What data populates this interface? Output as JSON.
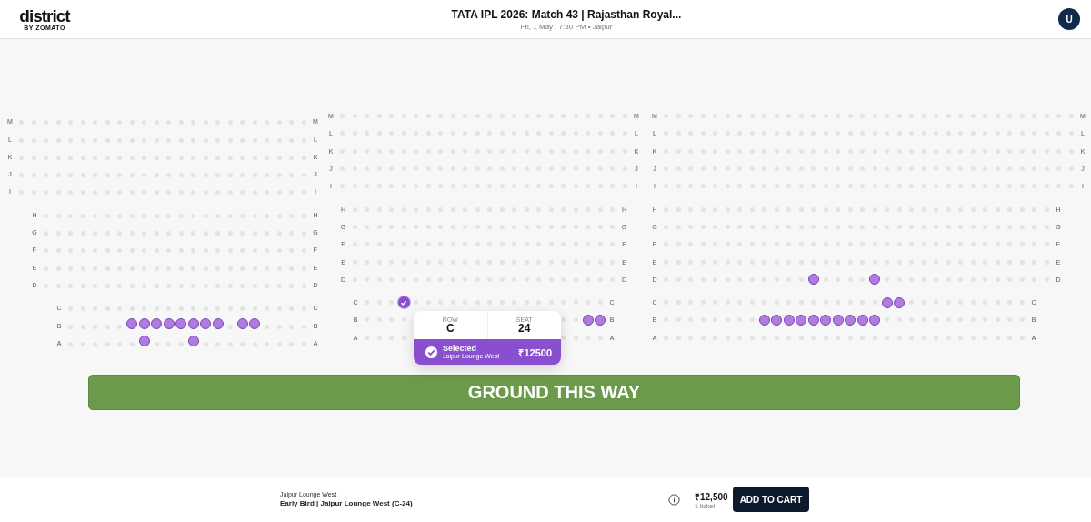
{
  "header": {
    "logo": "district",
    "logo_sub": "BY ZOMATO",
    "title": "TATA IPL 2026: Match 43 | Rajasthan Royal...",
    "subtitle": "Fri, 1 May | 7:30 PM • Jaipur",
    "avatar": "U"
  },
  "blocks": [
    {
      "tiers": [
        {
          "rows": [
            {
              "label_left": "M",
              "label_right": "M",
              "available": [
                false,
                false,
                false,
                false,
                false,
                false,
                false,
                false,
                false,
                false,
                false,
                false,
                false,
                false,
                false,
                false,
                false,
                false,
                false,
                false,
                false,
                false,
                false,
                false
              ]
            },
            {
              "label_left": "L",
              "label_right": "L",
              "available": [
                false,
                false,
                false,
                false,
                false,
                false,
                false,
                false,
                false,
                false,
                false,
                false,
                false,
                false,
                false,
                false,
                false,
                false,
                false,
                false,
                false,
                false,
                false,
                false
              ]
            },
            {
              "label_left": "K",
              "label_right": "K",
              "available": [
                false,
                false,
                false,
                false,
                false,
                false,
                false,
                false,
                false,
                false,
                false,
                false,
                false,
                false,
                false,
                false,
                false,
                false,
                false,
                false,
                false,
                false,
                false,
                false
              ]
            },
            {
              "label_left": "J",
              "label_right": "J",
              "available": [
                false,
                false,
                false,
                false,
                false,
                false,
                false,
                false,
                false,
                false,
                false,
                false,
                false,
                false,
                false,
                false,
                false,
                false,
                false,
                false,
                false,
                false,
                false,
                false
              ]
            },
            {
              "label_left": "I",
              "label_right": "I",
              "available": [
                false,
                false,
                false,
                false,
                false,
                false,
                false,
                false,
                false,
                false,
                false,
                false,
                false,
                false,
                false,
                false,
                false,
                false,
                false,
                false,
                false,
                false,
                false,
                false
              ]
            }
          ]
        },
        {
          "rows": [
            {
              "label_left": "H",
              "label_right": "H",
              "available": [
                false,
                false,
                false,
                false,
                false,
                false,
                false,
                false,
                false,
                false,
                false,
                false,
                false,
                false,
                false,
                false,
                false,
                false,
                false,
                false,
                false,
                false
              ]
            },
            {
              "label_left": "G",
              "label_right": "G",
              "available": [
                false,
                false,
                false,
                false,
                false,
                false,
                false,
                false,
                false,
                false,
                false,
                false,
                false,
                false,
                false,
                false,
                false,
                false,
                false,
                false,
                false,
                false
              ]
            },
            {
              "label_left": "F",
              "label_right": "F",
              "available": [
                false,
                false,
                false,
                false,
                false,
                false,
                false,
                false,
                false,
                false,
                false,
                false,
                false,
                false,
                false,
                false,
                false,
                false,
                false,
                false,
                false,
                false
              ]
            },
            {
              "label_left": "E",
              "label_right": "E",
              "available": [
                false,
                false,
                false,
                false,
                false,
                false,
                false,
                false,
                false,
                false,
                false,
                false,
                false,
                false,
                false,
                false,
                false,
                false,
                false,
                false,
                false,
                false
              ]
            },
            {
              "label_left": "D",
              "label_right": "D",
              "available": [
                false,
                false,
                false,
                false,
                false,
                false,
                false,
                false,
                false,
                false,
                false,
                false,
                false,
                false,
                false,
                false,
                false,
                false,
                false,
                false,
                false,
                false
              ]
            }
          ]
        },
        {
          "rows": [
            {
              "label_left": "C",
              "label_right": "C",
              "available": [
                false,
                false,
                false,
                false,
                false,
                false,
                false,
                false,
                false,
                false,
                false,
                false,
                false,
                false,
                false,
                false,
                false,
                false,
                false,
                false
              ]
            },
            {
              "label_left": "B",
              "label_right": "B",
              "available": [
                false,
                false,
                false,
                false,
                false,
                true,
                true,
                true,
                true,
                true,
                true,
                true,
                true,
                false,
                true,
                true,
                false,
                false,
                false,
                false
              ]
            },
            {
              "label_left": "A",
              "label_right": "A",
              "available": [
                false,
                false,
                false,
                false,
                false,
                false,
                true,
                false,
                false,
                false,
                true,
                false,
                false,
                false,
                false,
                false,
                false,
                false,
                false,
                false
              ]
            }
          ]
        }
      ]
    },
    {
      "tiers": [
        {
          "rows": [
            {
              "label_left": "M",
              "label_right": "M",
              "available": [
                false,
                false,
                false,
                false,
                false,
                false,
                false,
                false,
                false,
                false,
                false,
                false,
                false,
                false,
                false,
                false,
                false,
                false,
                false,
                false,
                false,
                false,
                false,
                false
              ]
            },
            {
              "label_left": "L",
              "label_right": "L",
              "available": [
                false,
                false,
                false,
                false,
                false,
                false,
                false,
                false,
                false,
                false,
                false,
                false,
                false,
                false,
                false,
                false,
                false,
                false,
                false,
                false,
                false,
                false,
                false,
                false
              ]
            },
            {
              "label_left": "K",
              "label_right": "K",
              "available": [
                false,
                false,
                false,
                false,
                false,
                false,
                false,
                false,
                false,
                false,
                false,
                false,
                false,
                false,
                false,
                false,
                false,
                false,
                false,
                false,
                false,
                false,
                false,
                false
              ]
            },
            {
              "label_left": "J",
              "label_right": "J",
              "available": [
                false,
                false,
                false,
                false,
                false,
                false,
                false,
                false,
                false,
                false,
                false,
                false,
                false,
                false,
                false,
                false,
                false,
                false,
                false,
                false,
                false,
                false,
                false,
                false
              ]
            },
            {
              "label_left": "I",
              "label_right": "I",
              "available": [
                false,
                false,
                false,
                false,
                false,
                false,
                false,
                false,
                false,
                false,
                false,
                false,
                false,
                false,
                false,
                false,
                false,
                false,
                false,
                false,
                false,
                false,
                false,
                false
              ]
            }
          ]
        },
        {
          "rows": [
            {
              "label_left": "H",
              "label_right": "H",
              "available": [
                false,
                false,
                false,
                false,
                false,
                false,
                false,
                false,
                false,
                false,
                false,
                false,
                false,
                false,
                false,
                false,
                false,
                false,
                false,
                false,
                false,
                false
              ]
            },
            {
              "label_left": "G",
              "label_right": "G",
              "available": [
                false,
                false,
                false,
                false,
                false,
                false,
                false,
                false,
                false,
                false,
                false,
                false,
                false,
                false,
                false,
                false,
                false,
                false,
                false,
                false,
                false,
                false
              ]
            },
            {
              "label_left": "F",
              "label_right": "F",
              "available": [
                false,
                false,
                false,
                false,
                false,
                false,
                false,
                false,
                false,
                false,
                false,
                false,
                false,
                false,
                false,
                false,
                false,
                false,
                false,
                false,
                false,
                false
              ]
            },
            {
              "label_left": "E",
              "label_right": "E",
              "available": [
                false,
                false,
                false,
                false,
                false,
                false,
                false,
                false,
                false,
                false,
                false,
                false,
                false,
                false,
                false,
                false,
                false,
                false,
                false,
                false,
                false,
                false
              ]
            },
            {
              "label_left": "D",
              "label_right": "D",
              "available": [
                false,
                false,
                false,
                false,
                false,
                false,
                false,
                false,
                false,
                false,
                false,
                false,
                false,
                false,
                false,
                false,
                false,
                false,
                false,
                false,
                false,
                false
              ]
            }
          ]
        },
        {
          "rows": [
            {
              "label_left": "C",
              "label_right": "C",
              "available": [
                false,
                false,
                false,
                true,
                false,
                false,
                false,
                false,
                false,
                false,
                false,
                false,
                false,
                false,
                false,
                false,
                false,
                false,
                false,
                false
              ],
              "selected": [
                false,
                false,
                false,
                true,
                false,
                false,
                false,
                false,
                false,
                false,
                false,
                false,
                false,
                false,
                false,
                false,
                false,
                false,
                false,
                false
              ]
            },
            {
              "label_left": "B",
              "label_right": "B",
              "available": [
                false,
                false,
                false,
                false
              ],
              "available_after": [
                false,
                false,
                true,
                true
              ]
            },
            {
              "label_left": "A",
              "label_right": "A",
              "available": [
                false,
                false,
                false,
                false
              ],
              "available_after": [
                false,
                false,
                false,
                false
              ]
            }
          ]
        }
      ]
    },
    {
      "tiers": [
        {
          "rows": [
            {
              "label_left": "M",
              "label_right": "M",
              "available": [
                false,
                false,
                false,
                false,
                false,
                false,
                false,
                false,
                false,
                false,
                false,
                false,
                false,
                false,
                false,
                false,
                false,
                false,
                false,
                false,
                false,
                false,
                false,
                false,
                false,
                false,
                false,
                false,
                false,
                false,
                false,
                false,
                false,
                false
              ]
            },
            {
              "label_left": "L",
              "label_right": "L",
              "available": [
                false,
                false,
                false,
                false,
                false,
                false,
                false,
                false,
                false,
                false,
                false,
                false,
                false,
                false,
                false,
                false,
                false,
                false,
                false,
                false,
                false,
                false,
                false,
                false,
                false,
                false,
                false,
                false,
                false,
                false,
                false,
                false,
                false,
                false
              ]
            },
            {
              "label_left": "K",
              "label_right": "K",
              "available": [
                false,
                false,
                false,
                false,
                false,
                false,
                false,
                false,
                false,
                false,
                false,
                false,
                false,
                false,
                false,
                false,
                false,
                false,
                false,
                false,
                false,
                false,
                false,
                false,
                false,
                false,
                false,
                false,
                false,
                false,
                false,
                false,
                false,
                false
              ]
            },
            {
              "label_left": "J",
              "label_right": "J",
              "available": [
                false,
                false,
                false,
                false,
                false,
                false,
                false,
                false,
                false,
                false,
                false,
                false,
                false,
                false,
                false,
                false,
                false,
                false,
                false,
                false,
                false,
                false,
                false,
                false,
                false,
                false,
                false,
                false,
                false,
                false,
                false,
                false,
                false,
                false
              ]
            },
            {
              "label_left": "I",
              "label_right": "I",
              "available": [
                false,
                false,
                false,
                false,
                false,
                false,
                false,
                false,
                false,
                false,
                false,
                false,
                false,
                false,
                false,
                false,
                false,
                false,
                false,
                false,
                false,
                false,
                false,
                false,
                false,
                false,
                false,
                false,
                false,
                false,
                false,
                false,
                false,
                false
              ]
            }
          ]
        },
        {
          "rows": [
            {
              "label_left": "H",
              "label_right": "H",
              "available": [
                false,
                false,
                false,
                false,
                false,
                false,
                false,
                false,
                false,
                false,
                false,
                false,
                false,
                false,
                false,
                false,
                false,
                false,
                false,
                false,
                false,
                false,
                false,
                false,
                false,
                false,
                false,
                false,
                false,
                false,
                false,
                false
              ]
            },
            {
              "label_left": "G",
              "label_right": "G",
              "available": [
                false,
                false,
                false,
                false,
                false,
                false,
                false,
                false,
                false,
                false,
                false,
                false,
                false,
                false,
                false,
                false,
                false,
                false,
                false,
                false,
                false,
                false,
                false,
                false,
                false,
                false,
                false,
                false,
                false,
                false,
                false,
                false
              ]
            },
            {
              "label_left": "F",
              "label_right": "F",
              "available": [
                false,
                false,
                false,
                false,
                false,
                false,
                false,
                false,
                false,
                false,
                false,
                false,
                false,
                false,
                false,
                false,
                false,
                false,
                false,
                false,
                false,
                false,
                false,
                false,
                false,
                false,
                false,
                false,
                false,
                false,
                false,
                false
              ]
            },
            {
              "label_left": "E",
              "label_right": "E",
              "available": [
                false,
                false,
                false,
                false,
                false,
                false,
                false,
                false,
                false,
                false,
                false,
                false,
                false,
                false,
                false,
                false,
                false,
                false,
                false,
                false,
                false,
                false,
                false,
                false,
                false,
                false,
                false,
                false,
                false,
                false,
                false,
                false
              ]
            },
            {
              "label_left": "D",
              "label_right": "D",
              "available": [
                false,
                false,
                false,
                false,
                false,
                false,
                false,
                false,
                false,
                false,
                false,
                false,
                true,
                false,
                false,
                false,
                false,
                true,
                false,
                false,
                false,
                false,
                false,
                false,
                false,
                false,
                false,
                false,
                false,
                false,
                false,
                false
              ]
            }
          ]
        },
        {
          "rows": [
            {
              "label_left": "C",
              "label_right": "C",
              "available": [
                false,
                false,
                false,
                false,
                false,
                false,
                false,
                false,
                false,
                false,
                false,
                false,
                false,
                false,
                false,
                false,
                false,
                false,
                true,
                true,
                false,
                false,
                false,
                false,
                false,
                false,
                false,
                false,
                false,
                false
              ]
            },
            {
              "label_left": "B",
              "label_right": "B",
              "available": [
                false,
                false,
                false,
                false,
                false,
                false,
                false,
                false,
                true,
                true,
                true,
                true,
                true,
                true,
                true,
                true,
                true,
                true,
                false,
                false,
                false,
                false,
                false,
                false,
                false,
                false,
                false,
                false,
                false,
                false
              ]
            },
            {
              "label_left": "A",
              "label_right": "A",
              "available": [
                false,
                false,
                false,
                false,
                false,
                false,
                false,
                false,
                false,
                false,
                false,
                false,
                false,
                false,
                false,
                false,
                false,
                false,
                false,
                false,
                false,
                false,
                false,
                false,
                false,
                false,
                false,
                false,
                false,
                false
              ]
            }
          ]
        }
      ]
    }
  ],
  "popup": {
    "row_label": "ROW",
    "row": "C",
    "seat_label": "SEAT",
    "seat": "24",
    "status": "Selected",
    "section": "Jaipur Lounge West",
    "price": "₹12500"
  },
  "ground": "GROUND THIS WAY",
  "footer": {
    "section": "Jaipur Lounge West",
    "ticket": "Early Bird | Jaipur Lounge West (C-24)",
    "price": "₹12,500",
    "count": "1 ticket",
    "button": "ADD TO CART"
  }
}
